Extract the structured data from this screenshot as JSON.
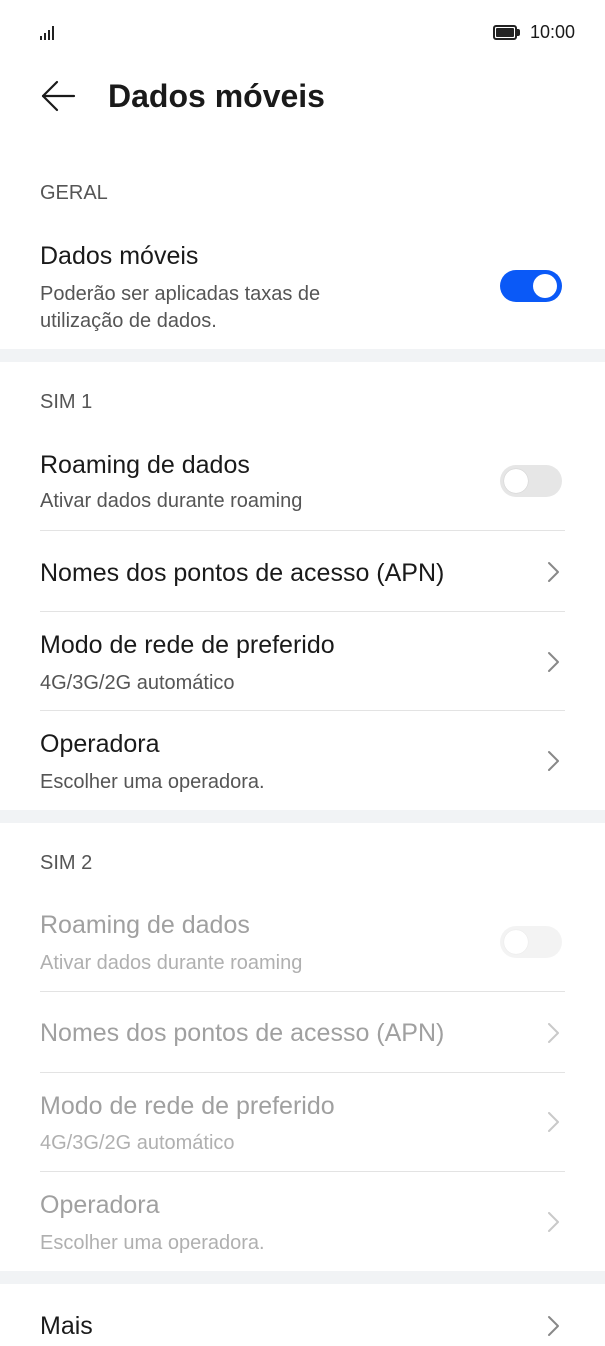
{
  "status_bar": {
    "time": "10:00"
  },
  "header": {
    "title": "Dados móveis"
  },
  "sections": {
    "geral": {
      "label": "GERAL",
      "mobile_data": {
        "title": "Dados móveis",
        "subtitle_line1": "Poderão ser aplicadas taxas de",
        "subtitle_line2": "utilização de dados.",
        "enabled": true
      }
    },
    "sim1": {
      "label": "SIM 1",
      "roaming": {
        "title": "Roaming de dados",
        "subtitle": "Ativar dados durante roaming",
        "enabled": false
      },
      "apn": {
        "title": "Nomes dos pontos de acesso (APN)"
      },
      "network_mode": {
        "title": "Modo de rede de preferido",
        "subtitle": "4G/3G/2G automático"
      },
      "operator": {
        "title": "Operadora",
        "subtitle": "Escolher uma operadora."
      }
    },
    "sim2": {
      "label": "SIM 2",
      "roaming": {
        "title": "Roaming de dados",
        "subtitle": "Ativar dados durante roaming",
        "enabled": false
      },
      "apn": {
        "title": "Nomes dos pontos de acesso (APN)"
      },
      "network_mode": {
        "title": "Modo de rede de preferido",
        "subtitle": "4G/3G/2G automático"
      },
      "operator": {
        "title": "Operadora",
        "subtitle": "Escolher uma operadora."
      }
    },
    "more": {
      "title": "Mais"
    }
  },
  "colors": {
    "accent": "#0a59f7",
    "band": "#f1f3f5",
    "toggle_off": "#e6e6e6"
  },
  "icons": [
    "signal-icon",
    "battery-icon",
    "back-arrow-icon",
    "chevron-right-icon"
  ]
}
